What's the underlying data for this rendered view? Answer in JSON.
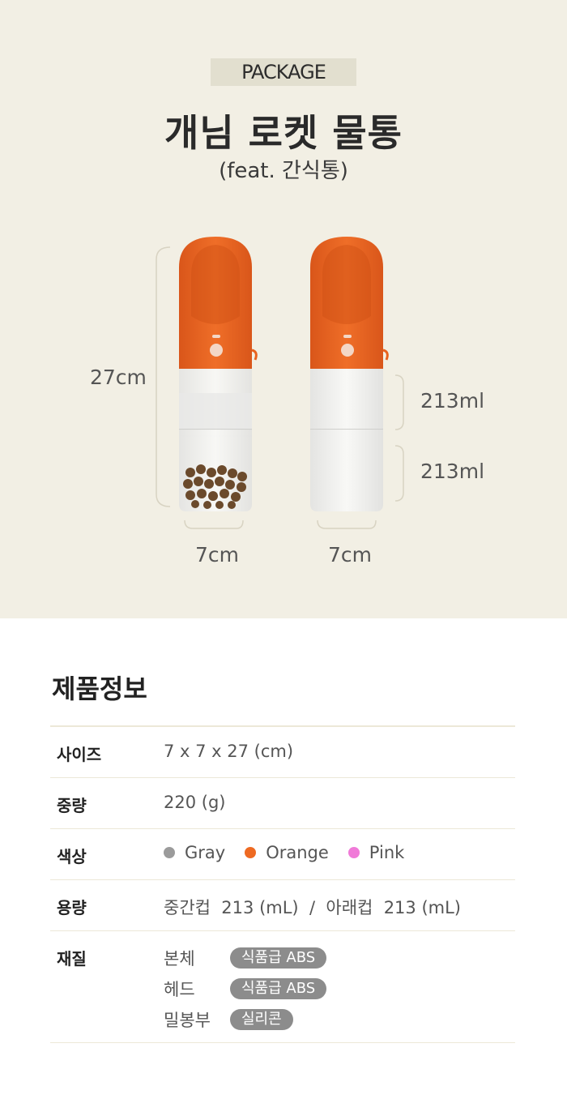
{
  "header": {
    "badge": "PACKAGE",
    "title": "개님 로켓 물통",
    "subtitle": "(feat. 간식통)"
  },
  "dimensions": {
    "height": "27cm",
    "width_left": "7cm",
    "width_right": "7cm",
    "capacity_top": "213ml",
    "capacity_bottom": "213ml"
  },
  "info": {
    "title": "제품정보",
    "rows": {
      "size": {
        "label": "사이즈",
        "value": "7 x 7 x 27 (cm)"
      },
      "weight": {
        "label": "중량",
        "value": "220 (g)"
      },
      "color": {
        "label": "색상",
        "options": [
          {
            "name": "Gray",
            "color": "#9b9b9b"
          },
          {
            "name": "Orange",
            "color": "#ee6a22"
          },
          {
            "name": "Pink",
            "color": "#f07ad8"
          }
        ]
      },
      "capacity": {
        "label": "용량",
        "value": "중간컵  213 (mL)  /  아래컵  213 (mL)"
      },
      "material": {
        "label": "재질",
        "items": [
          {
            "name": "본체",
            "tag": "식품급 ABS"
          },
          {
            "name": "헤드",
            "tag": "식품급 ABS"
          },
          {
            "name": "밀봉부",
            "tag": "실리콘"
          }
        ]
      }
    }
  },
  "colors": {
    "background": "#f2efe4",
    "bottle_orange": "#e8621e"
  }
}
